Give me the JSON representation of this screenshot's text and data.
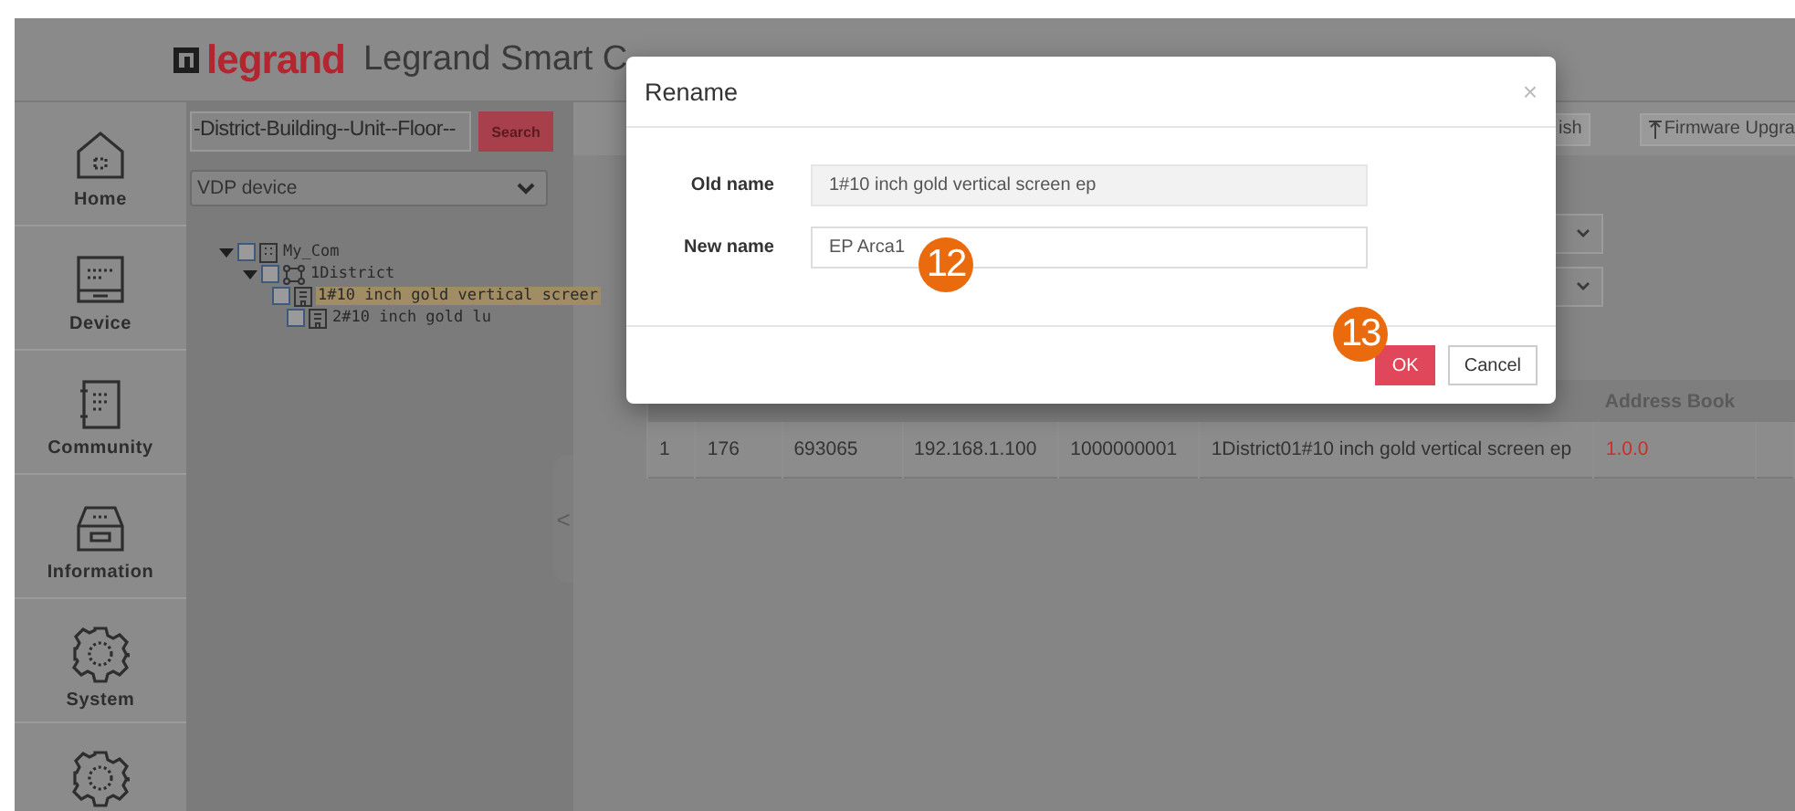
{
  "header": {
    "logo": "legrand",
    "title": "Legrand Smart C"
  },
  "nav": [
    {
      "kind": "home",
      "label": "Home"
    },
    {
      "kind": "device",
      "label": "Device"
    },
    {
      "kind": "community",
      "label": "Community"
    },
    {
      "kind": "information",
      "label": "Information"
    },
    {
      "kind": "gear",
      "label": "System"
    },
    {
      "kind": "gear"
    }
  ],
  "tree_panel": {
    "search": {
      "value": "-District-Building--Unit--Floor--",
      "button": "Search"
    },
    "filter": {
      "value": "VDP device"
    },
    "tree": [
      {
        "kind": "community",
        "label": "My_Com",
        "expanded": true,
        "checked": false,
        "selected": false,
        "children": [
          {
            "kind": "district",
            "label": "1District",
            "expanded": true,
            "checked": false,
            "selected": false,
            "children": [
              {
                "kind": "device",
                "label": "1#10 inch gold vertical screer",
                "checked": false,
                "selected": true
              },
              {
                "kind": "device",
                "label": "2#10 inch gold lu",
                "checked": false,
                "selected": false
              }
            ]
          }
        ]
      }
    ],
    "collapse_handle": "<"
  },
  "toolbar": {
    "buttons": [
      {
        "kind": "plain",
        "label": "ish"
      },
      {
        "kind": "upload",
        "label": "Firmware Upgra"
      }
    ]
  },
  "filters": [
    {
      "kind": "dropdown"
    },
    {
      "kind": "dropdown"
    }
  ],
  "table": {
    "columns": [
      {},
      {},
      {},
      {},
      {},
      {},
      {
        "label": "Address Book"
      }
    ],
    "rows": [
      {
        "cells": [
          {
            "text": "1"
          },
          {
            "text": "176"
          },
          {
            "text": "693065"
          },
          {
            "text": "192.168.1.100"
          },
          {
            "text": "1000000001"
          },
          {
            "text": "1District01#10 inch gold vertical screen ep"
          },
          {
            "text": "1.0.0",
            "color": "#c9302c"
          }
        ]
      }
    ]
  },
  "dialog": {
    "title": "Rename",
    "close": "×",
    "fields": [
      {
        "label": "Old name",
        "value": "1#10 inch gold vertical screen ep",
        "disabled": true
      },
      {
        "label": "New name",
        "value": "EP Arca1",
        "disabled": false
      }
    ],
    "buttons": [
      {
        "kind": "primary",
        "label": "OK"
      },
      {
        "kind": "default",
        "label": "Cancel"
      }
    ]
  },
  "annotations": [
    {
      "text": "12"
    },
    {
      "text": "13"
    }
  ]
}
